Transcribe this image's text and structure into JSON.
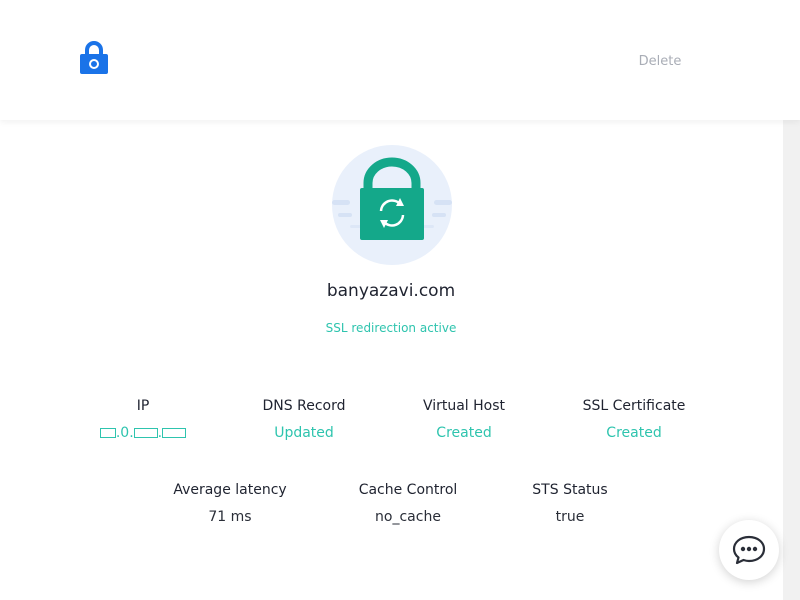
{
  "header": {
    "logo_icon": "lock-icon",
    "delete_label": "Delete"
  },
  "site": {
    "domain": "banyazavi.com",
    "status": "SSL redirection active"
  },
  "stats_row1": [
    {
      "label": "IP",
      "value": "⬜.0.⬜.⬜"
    },
    {
      "label": "DNS Record",
      "value": "Updated"
    },
    {
      "label": "Virtual Host",
      "value": "Created"
    },
    {
      "label": "SSL Certificate",
      "value": "Created"
    }
  ],
  "stats_row2": [
    {
      "label": "Average latency",
      "value": "71 ms"
    },
    {
      "label": "Cache Control",
      "value": "no_cache"
    },
    {
      "label": "STS Status",
      "value": "true"
    }
  ],
  "colors": {
    "accent_blue": "#1a73e8",
    "accent_teal": "#2ec4ae",
    "lock_green": "#14a88a"
  },
  "chat_icon": "chat-bubble-icon"
}
